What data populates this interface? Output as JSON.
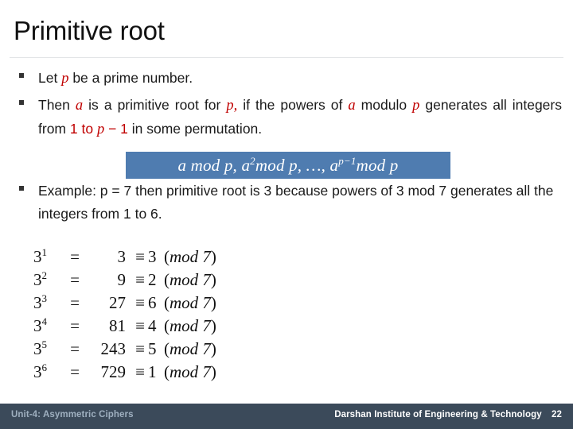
{
  "slide": {
    "title": "Primitive root",
    "page_number": "22"
  },
  "bullets": [
    {
      "id": "bullet-prime",
      "segments": [
        {
          "text": "Let ",
          "style": "plain"
        },
        {
          "text": "p",
          "style": "var-red"
        },
        {
          "text": " be a prime number.",
          "style": "plain"
        }
      ]
    },
    {
      "id": "bullet-definition",
      "segments": [
        {
          "text": "Then ",
          "style": "plain"
        },
        {
          "text": "a",
          "style": "var-red"
        },
        {
          "text": " is a primitive root for ",
          "style": "plain"
        },
        {
          "text": "p,",
          "style": "var-red"
        },
        {
          "text": " if the powers of ",
          "style": "plain"
        },
        {
          "text": "a",
          "style": "var-red"
        },
        {
          "text": " modulo ",
          "style": "plain"
        },
        {
          "text": "p",
          "style": "var-red"
        },
        {
          "text": " generates all integers from ",
          "style": "plain"
        },
        {
          "text": "1 to ",
          "style": "red"
        },
        {
          "text": "p",
          "style": "var-red"
        },
        {
          "text": " − 1",
          "style": "red"
        },
        {
          "text": " in some permutation.",
          "style": "plain"
        }
      ]
    },
    {
      "id": "bullet-example",
      "segments": [
        {
          "text": "Example: p = 7 then primitive root is 3 because powers of 3 mod 7 generates all the integers from 1 to 6.",
          "style": "plain"
        }
      ]
    }
  ],
  "formula": {
    "label": "powers-sequence",
    "base": "a",
    "parts": [
      {
        "base": "a",
        "exp": "",
        "mod": "mod p"
      },
      {
        "base": "a",
        "exp": "2",
        "mod": "mod p"
      },
      {
        "base": "…",
        "exp": "",
        "mod": ""
      },
      {
        "base": "a",
        "exp": "p−1",
        "mod": "mod p"
      }
    ],
    "plain": "a mod p, a² mod p, …, a^(p−1) mod p",
    "background_color": "#4F7CB0",
    "text_color": "#FFFFFF"
  },
  "equations": {
    "modulus": "7",
    "base": "3",
    "eq_sign": "=",
    "congruence_sign": "≡",
    "mod_open": "(",
    "mod_word": "mod",
    "mod_close": ")",
    "rows": [
      {
        "exponent": "1",
        "value": "3",
        "residue": "3"
      },
      {
        "exponent": "2",
        "value": "9",
        "residue": "2"
      },
      {
        "exponent": "3",
        "value": "27",
        "residue": "6"
      },
      {
        "exponent": "4",
        "value": "81",
        "residue": "4"
      },
      {
        "exponent": "5",
        "value": "243",
        "residue": "5"
      },
      {
        "exponent": "6",
        "value": "729",
        "residue": "1"
      }
    ]
  },
  "footer": {
    "left_text": "Unit-4: Asymmetric Ciphers",
    "institute": "Darshan Institute of Engineering & Technology",
    "page": "22",
    "background_color": "#3B4A5A",
    "left_text_color": "#9FB0C0",
    "right_text_color": "#FFFFFF"
  },
  "theme": {
    "accent_red": "#C00000",
    "highlight_blue": "#4F7CB0",
    "footer_slate": "#3B4A5A",
    "divider_gray": "#E2E4E6"
  }
}
